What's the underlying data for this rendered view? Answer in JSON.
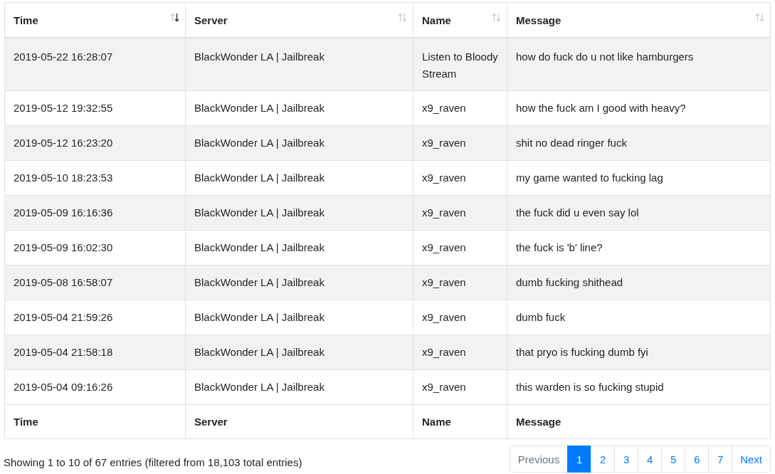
{
  "table": {
    "columns": [
      {
        "label": "Time",
        "sorted": true
      },
      {
        "label": "Server",
        "sorted": false
      },
      {
        "label": "Name",
        "sorted": false
      },
      {
        "label": "Message",
        "sorted": false
      }
    ],
    "rows": [
      [
        "2019-05-22 16:28:07",
        "BlackWonder LA | Jailbreak",
        "Listen to Bloody Stream",
        "how do fuck do u not like hamburgers"
      ],
      [
        "2019-05-12 19:32:55",
        "BlackWonder LA | Jailbreak",
        "x9_raven",
        "how the fuck am I good with heavy?"
      ],
      [
        "2019-05-12 16:23:20",
        "BlackWonder LA | Jailbreak",
        "x9_raven",
        "shit no dead ringer fuck"
      ],
      [
        "2019-05-10 18:23:53",
        "BlackWonder LA | Jailbreak",
        "x9_raven",
        "my game wanted to fucking lag"
      ],
      [
        "2019-05-09 16:16:36",
        "BlackWonder LA | Jailbreak",
        "x9_raven",
        "the fuck did u even say lol"
      ],
      [
        "2019-05-09 16:02:30",
        "BlackWonder LA | Jailbreak",
        "x9_raven",
        "the fuck is 'b' line?"
      ],
      [
        "2019-05-08 16:58:07",
        "BlackWonder LA | Jailbreak",
        "x9_raven",
        "dumb fucking shithead"
      ],
      [
        "2019-05-04 21:59:26",
        "BlackWonder LA | Jailbreak",
        "x9_raven",
        "dumb fuck"
      ],
      [
        "2019-05-04 21:58:18",
        "BlackWonder LA | Jailbreak",
        "x9_raven",
        "that pryo is fucking dumb fyi"
      ],
      [
        "2019-05-04 09:16:26",
        "BlackWonder LA | Jailbreak",
        "x9_raven",
        "this warden is so fucking stupid"
      ]
    ],
    "footer": [
      "Time",
      "Server",
      "Name",
      "Message"
    ]
  },
  "info": "Showing 1 to 10 of 67 entries (filtered from 18,103 total entries)",
  "pagination": [
    {
      "label": "Previous",
      "disabled": true,
      "selected": false
    },
    {
      "label": "1",
      "disabled": false,
      "selected": true
    },
    {
      "label": "2",
      "disabled": false,
      "selected": false
    },
    {
      "label": "3",
      "disabled": false,
      "selected": false
    },
    {
      "label": "4",
      "disabled": false,
      "selected": false
    },
    {
      "label": "5",
      "disabled": false,
      "selected": false
    },
    {
      "label": "6",
      "disabled": false,
      "selected": false
    },
    {
      "label": "7",
      "disabled": false,
      "selected": false
    },
    {
      "label": "Next",
      "disabled": false,
      "selected": false
    }
  ]
}
